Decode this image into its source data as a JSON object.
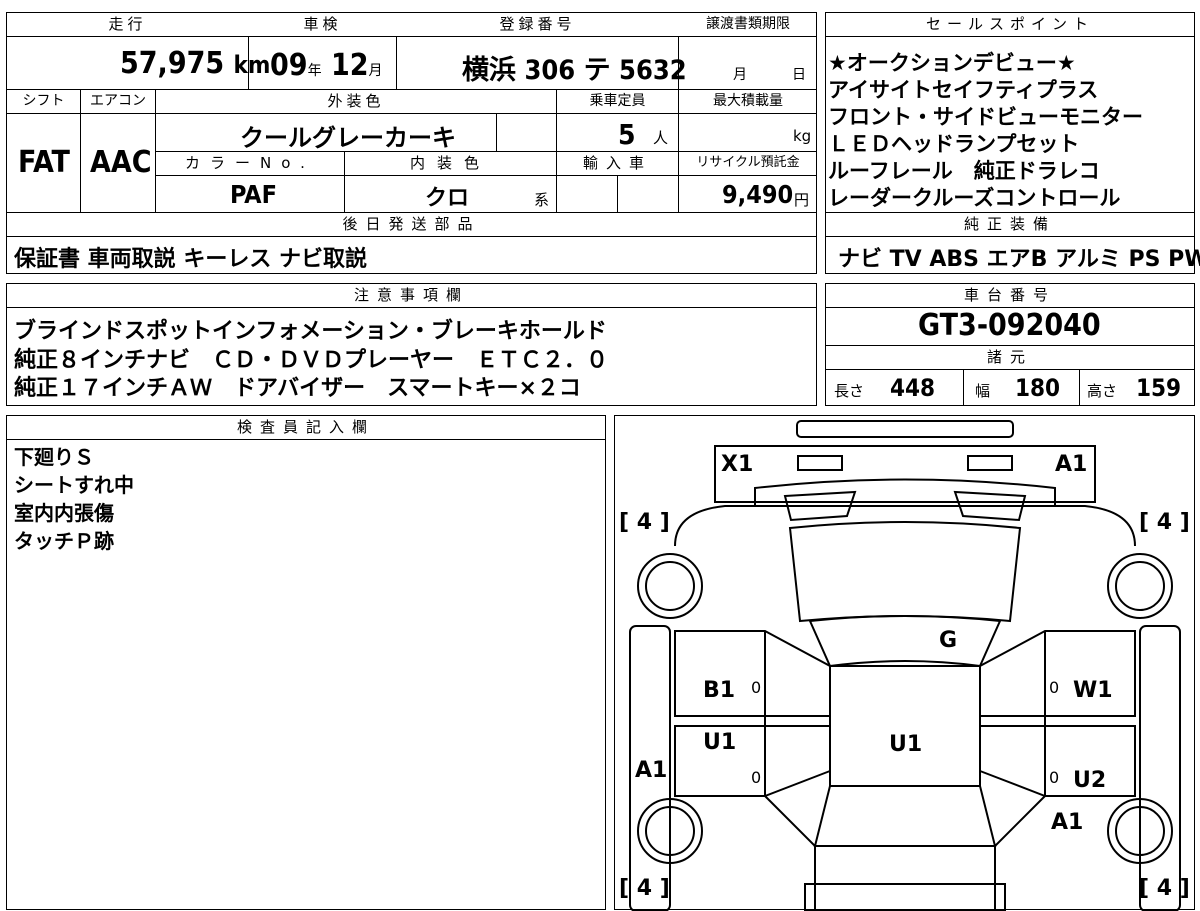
{
  "top": {
    "mileage_label": "走行",
    "mileage": "57,975",
    "mileage_unit": "km",
    "inspection_label": "車検",
    "inspection_year": "09",
    "inspection_year_unit": "年",
    "inspection_month": "12",
    "inspection_month_unit": "月",
    "registration_label": "登録番号",
    "registration_region": "横浜",
    "registration_number": "306 テ 5632",
    "transfer_label": "譲渡書類期限",
    "transfer_month_unit": "月",
    "transfer_day_unit": "日"
  },
  "mid": {
    "shift_label": "シフト",
    "shift": "FAT",
    "aircon_label": "エアコン",
    "aircon": "AAC",
    "exterior_label": "外装色",
    "exterior": "クールグレーカーキ",
    "capacity_label": "乗車定員",
    "capacity": "5",
    "capacity_unit": "人",
    "maxload_label": "最大積載量",
    "maxload_unit": "kg",
    "colorno_label": "カラーNo.",
    "colorno": "PAF",
    "interior_label": "内装色",
    "interior": "クロ",
    "interior_unit": "系",
    "import_label": "輸入車",
    "recycle_label": "リサイクル預託金",
    "recycle": "9,490",
    "recycle_unit": "円"
  },
  "later": {
    "label": "後日発送部品",
    "value": "保証書 車両取説 キーレス ナビ取説"
  },
  "sales": {
    "label": "セールスポイント",
    "lines": [
      "★オークションデビュー★",
      "アイサイトセイフティプラス",
      "フロント・サイドビューモニター",
      "ＬＥＤヘッドランプセット",
      "ルーフレール　純正ドラレコ",
      "レーダークルーズコントロール"
    ]
  },
  "equip": {
    "label": "純正装備",
    "value": "ナビ TV ABS エアB アルミ PS PW"
  },
  "notes": {
    "label": "注意事項欄",
    "lines": [
      "ブラインドスポットインフォメーション・ブレーキホールド",
      "純正８インチナビ　ＣＤ・ＤＶＤプレーヤー　ＥＴＣ２．０",
      "純正１７インチＡＷ　ドアバイザー　スマートキー×２コ"
    ]
  },
  "chassis": {
    "label": "車台番号",
    "value": "GT3-092040"
  },
  "specs": {
    "label": "諸元",
    "length_label": "長さ",
    "length": "448",
    "width_label": "幅",
    "width": "180",
    "height_label": "高さ",
    "height": "159"
  },
  "inspector": {
    "label": "検査員記入欄",
    "lines": [
      "下廻りＳ",
      "シートすれ中",
      "室内内張傷",
      "タッチＰ跡"
    ]
  },
  "diagram": {
    "marks": {
      "front_left": "X1",
      "front_right": "A1",
      "roof": "G",
      "left_front_door": "B1",
      "right_front_door": "W1",
      "left_rear_door": "U1",
      "center": "U1",
      "left_rear_quarter": "A1",
      "right_rear_door": "U2",
      "right_rear_quarter": "A1"
    },
    "zero": "0",
    "tyre_tread": "4",
    "bracket_open": "[",
    "bracket_close": "]"
  }
}
